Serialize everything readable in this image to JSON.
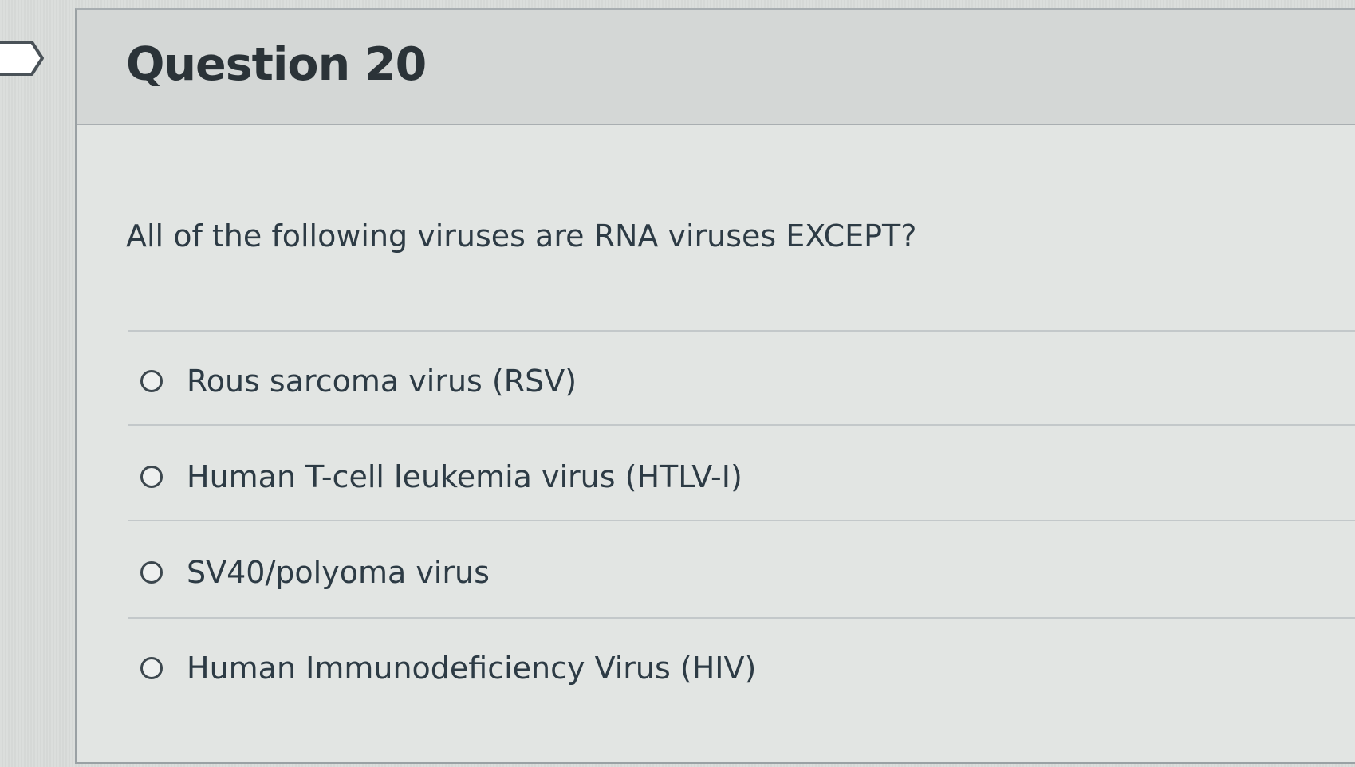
{
  "question": {
    "title": "Question 20",
    "text": "All of the following viruses are RNA viruses EXCEPT?",
    "answers": [
      {
        "label": "Rous sarcoma virus (RSV)",
        "selected": false
      },
      {
        "label": "Human T-cell leukemia virus (HTLV-I)",
        "selected": false
      },
      {
        "label": "SV40/polyoma virus",
        "selected": false
      },
      {
        "label": "Human Immunodeficiency Virus (HIV)",
        "selected": false
      }
    ]
  },
  "colors": {
    "text": "#2d3b45",
    "header_bg": "#d4d7d6",
    "card_bg": "#e2e5e3"
  },
  "icons": {
    "side_tab": "flag-tab-icon",
    "radio": "radio-button-icon"
  }
}
